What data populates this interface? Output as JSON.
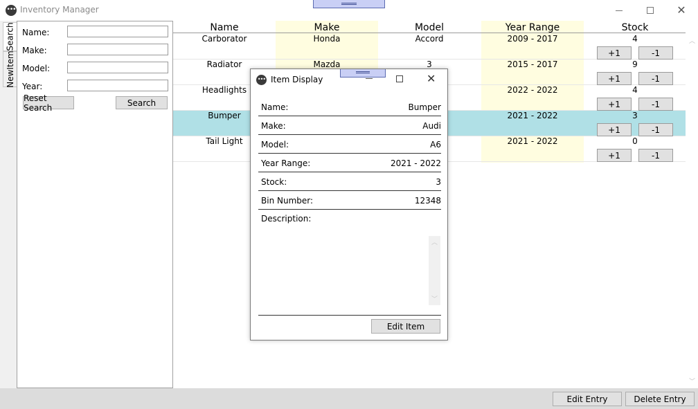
{
  "app": {
    "title": "Inventory Manager",
    "icon": "app-menu-icon"
  },
  "tabs": [
    {
      "label": "Search"
    },
    {
      "label": "NewItem"
    }
  ],
  "search": {
    "name_label": "Name:",
    "make_label": "Make:",
    "model_label": "Model:",
    "year_label": "Year:",
    "name_value": "",
    "make_value": "",
    "model_value": "",
    "year_value": "",
    "reset_label": "Reset Search",
    "search_label": "Search"
  },
  "table": {
    "headers": {
      "name": "Name",
      "make": "Make",
      "model": "Model",
      "year": "Year Range",
      "stock": "Stock"
    },
    "highlight_color": "#fffde0",
    "selected_color": "#b0e0e6",
    "rows": [
      {
        "name": "Carborator",
        "make": "Honda",
        "model": "Accord",
        "year": "2009 - 2017",
        "stock": "4",
        "plus": "+1",
        "minus": "-1"
      },
      {
        "name": "Radiator",
        "make": "Mazda",
        "model": "3",
        "year": "2015 - 2017",
        "stock": "9",
        "plus": "+1",
        "minus": "-1"
      },
      {
        "name": "Headlights",
        "make": "",
        "model": "",
        "year": "2022 - 2022",
        "stock": "4",
        "plus": "+1",
        "minus": "-1"
      },
      {
        "name": "Bumper",
        "make": "",
        "model": "",
        "year": "2021 - 2022",
        "stock": "3",
        "plus": "+1",
        "minus": "-1",
        "selected": true
      },
      {
        "name": "Tail Light",
        "make": "",
        "model": "",
        "year": "2021 - 2022",
        "stock": "0",
        "plus": "+1",
        "minus": "-1"
      }
    ]
  },
  "footer": {
    "edit_entry": "Edit Entry",
    "delete_entry": "Delete Entry"
  },
  "dialog": {
    "title": "Item Display",
    "fields": [
      {
        "label": "Name:",
        "value": "Bumper"
      },
      {
        "label": "Make:",
        "value": "Audi"
      },
      {
        "label": "Model:",
        "value": "A6"
      },
      {
        "label": "Year Range:",
        "value": "2021 - 2022"
      },
      {
        "label": "Stock:",
        "value": "3"
      },
      {
        "label": "Bin Number:",
        "value": "12348"
      }
    ],
    "description_label": "Description:",
    "description_value": "",
    "edit_label": "Edit Item"
  }
}
